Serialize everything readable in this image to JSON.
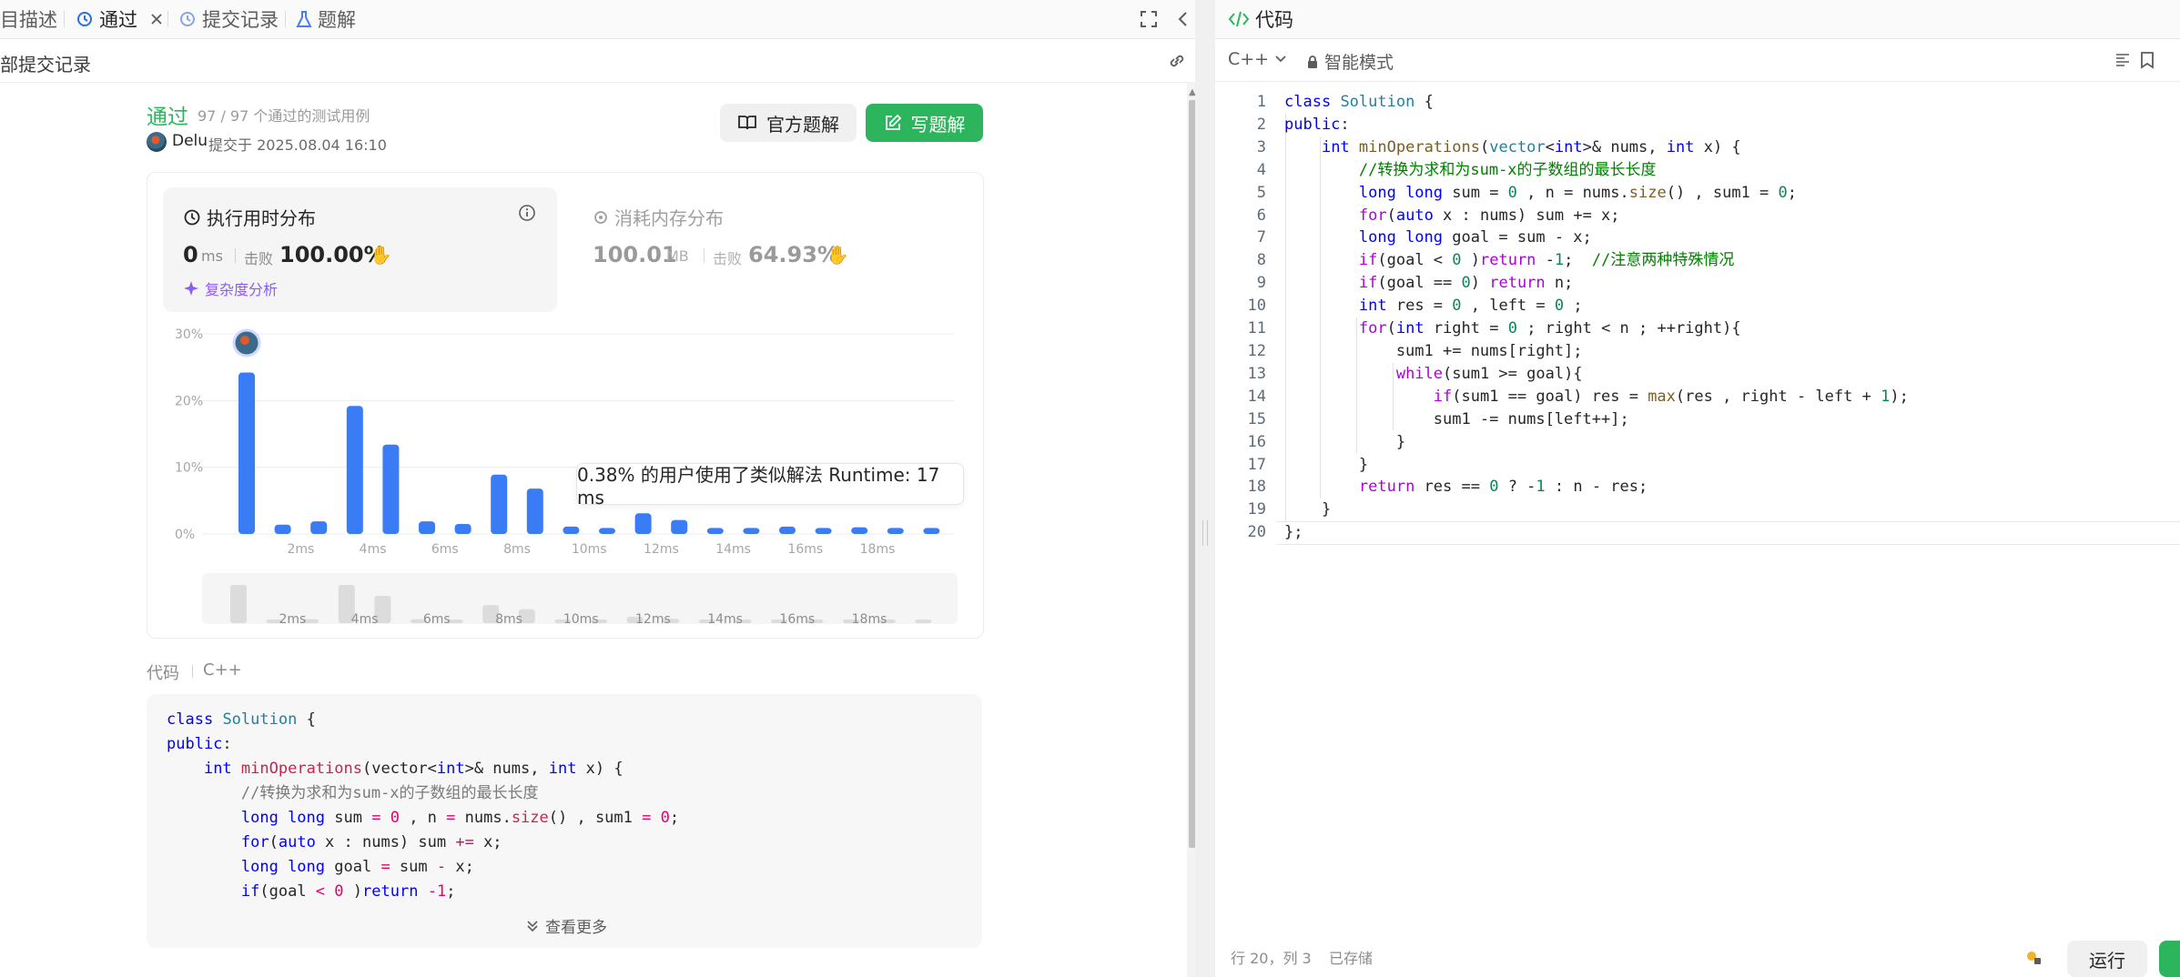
{
  "left_tabs": {
    "description": "目描述",
    "accepted": "通过",
    "submissions": "提交记录",
    "solutions": "题解"
  },
  "sub_header": {
    "all_submissions": "部提交记录"
  },
  "submission": {
    "status": "通过",
    "cases": "97 / 97 个通过的测试用例",
    "user": "Delu",
    "submitted_at": "提交于 2025.08.04 16:10",
    "official_solution_button": "官方题解",
    "write_solution_button": "写题解"
  },
  "runtime": {
    "title": "执行用时分布",
    "value": "0",
    "unit": "ms",
    "beats_label": "击败",
    "beats_value": "100.00%",
    "complexity_link": "复杂度分析"
  },
  "memory": {
    "title": "消耗内存分布",
    "value": "100.01",
    "unit": "MB",
    "beats_label": "击败",
    "beats_value": "64.93%"
  },
  "chart_data": {
    "type": "bar",
    "y_ticks": [
      "30%",
      "20%",
      "10%",
      "0%"
    ],
    "ylim": [
      0,
      30
    ],
    "x_tick_labels": [
      "2ms",
      "4ms",
      "6ms",
      "8ms",
      "10ms",
      "12ms",
      "14ms",
      "16ms",
      "18ms"
    ],
    "values": [
      24.2,
      1.4,
      1.9,
      19.2,
      13.4,
      1.9,
      1.5,
      8.9,
      6.8,
      1.1,
      0.9,
      3.1,
      2.1,
      0.9,
      0.9,
      1.1,
      0.9,
      1.0,
      0.9,
      0.9
    ],
    "mini_values": [
      24.2,
      1.4,
      1.9,
      19.2,
      13.4,
      1.9,
      1.5,
      8.9,
      6.8,
      1.1,
      0.9,
      3.1,
      2.1,
      0.9,
      0.9,
      1.1,
      0.9,
      1.0,
      0.9,
      0.9
    ],
    "bar_color": "#3a7cf6",
    "mini_bar_color": "#dcdcdc",
    "grid": true,
    "tooltip": "0.38% 的用户使用了类似解法 Runtime: 17 ms"
  },
  "code_section": {
    "label": "代码",
    "lang": "C++",
    "view_more": "查看更多"
  },
  "right_panel": {
    "tab": "代码",
    "lang": "C++",
    "mode": "智能模式",
    "cursor_position": "行 20，列 3",
    "saved_status": "已存储",
    "run_button": "运行"
  },
  "colors": {
    "accent_green": "#2db55d",
    "bar_blue": "#3a7cf6",
    "complexity_purple": "#8b5cf6"
  }
}
